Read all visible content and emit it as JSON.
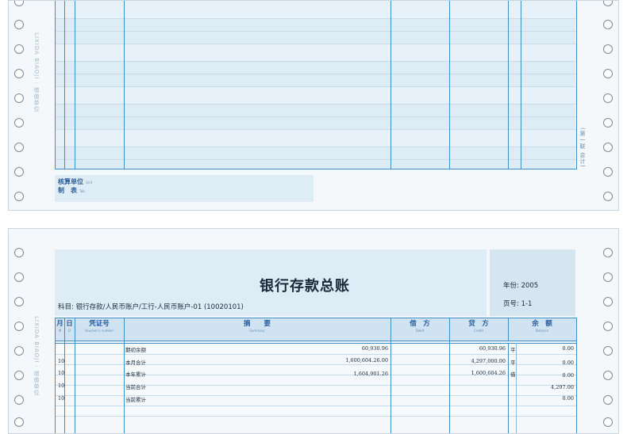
{
  "top_form": {
    "vertical_side_text": "LIXIDA BIAOJI · 增值单位",
    "vertical_right_text": "(第一联 会计)",
    "footer": {
      "unit_label": "核算单位",
      "unit_sub": "Unit",
      "maker_label": "制　表",
      "maker_sub": "Tab"
    }
  },
  "ledger": {
    "title": "银行存款总账",
    "subject_label": "科目:",
    "subject_value": "银行存款/人民币账户/工行-人民币账户-01 (10020101)",
    "year_label": "年份:",
    "year_value": "2005",
    "page_label": "页号:",
    "page_value": "1-1",
    "vertical_side_text": "LIXIDA BIAOJI · 增值单位",
    "headers": {
      "month": "月",
      "month_sub": "M",
      "day": "日",
      "day_sub": "D",
      "voucher": "凭证号",
      "voucher_sub": "Voucher's number",
      "summary": "摘　　要",
      "summary_sub": "Summary",
      "debit": "借　方",
      "debit_sub": "Debit",
      "credit": "贷　方",
      "credit_sub": "Credit",
      "balance": "余　额",
      "balance_sub": "Balance"
    },
    "rows": [
      {
        "month": "",
        "summary": "期初余额",
        "debit": "60,930.96",
        "credit": "60,930.96",
        "dir": "平",
        "balance": "0.00"
      },
      {
        "month": "10",
        "summary": "本月合计",
        "debit": "1,600,604.26.00",
        "credit": "4,297,000.00",
        "dir": "平",
        "balance": "0.00"
      },
      {
        "month": "10",
        "summary": "本年累计",
        "debit": "1,604,901.26",
        "credit": "1,600,604.26",
        "dir": "借",
        "balance": "0.00"
      },
      {
        "month": "10",
        "summary": "当前合计",
        "debit": "",
        "credit": "",
        "dir": "",
        "balance": "4,297.00"
      },
      {
        "month": "10",
        "summary": "当前累计",
        "debit": "",
        "credit": "",
        "dir": "",
        "balance": "0.00"
      }
    ]
  },
  "colors": {
    "grid_line": "#3e8fc6",
    "form_fill": "#deecf6",
    "text_dark": "#1a2a3a",
    "label_blue": "#2b5f9a"
  }
}
